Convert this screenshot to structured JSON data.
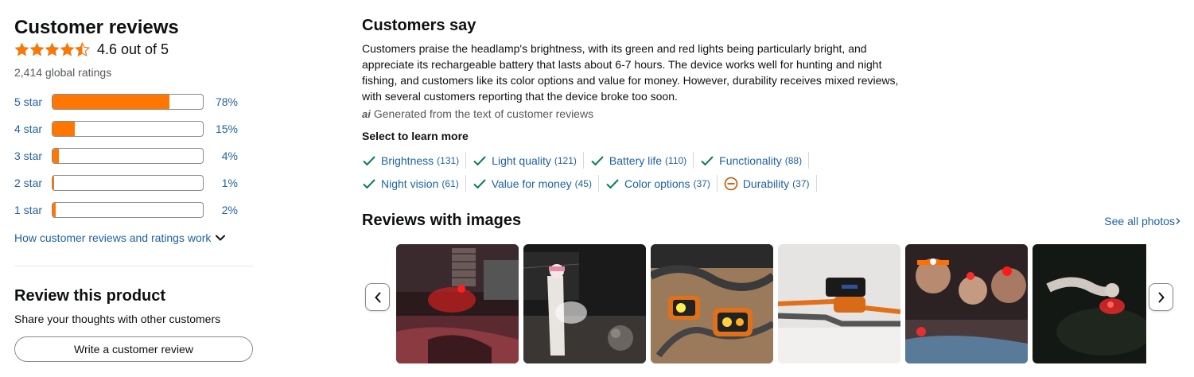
{
  "summary": {
    "title": "Customer reviews",
    "rating_value": 4.6,
    "rating_text": "4.6 out of 5",
    "global_ratings": "2,414 global ratings",
    "histogram": [
      {
        "label": "5 star",
        "percent": 78,
        "percent_text": "78%"
      },
      {
        "label": "4 star",
        "percent": 15,
        "percent_text": "15%"
      },
      {
        "label": "3 star",
        "percent": 4,
        "percent_text": "4%"
      },
      {
        "label": "2 star",
        "percent": 1,
        "percent_text": "1%"
      },
      {
        "label": "1 star",
        "percent": 2,
        "percent_text": "2%"
      }
    ],
    "how_link": "How customer reviews and ratings work"
  },
  "review_product": {
    "title": "Review this product",
    "subtitle": "Share your thoughts with other customers",
    "button_label": "Write a customer review"
  },
  "customers_say": {
    "title": "Customers say",
    "summary": "Customers praise the headlamp's brightness, with its green and red lights being particularly bright, and appreciate its rechargeable battery that lasts about 6-7 hours. The device works well for hunting and night fishing, and customers like its color options and value for money. However, durability receives mixed reviews, with several customers reporting that the device broke too soon.",
    "ai_icon": "ai",
    "ai_note": "Generated from the text of customer reviews",
    "select_label": "Select to learn more",
    "aspects": [
      [
        {
          "label": "Brightness",
          "count": "(131)",
          "sentiment": "positive"
        },
        {
          "label": "Light quality",
          "count": "(121)",
          "sentiment": "positive"
        },
        {
          "label": "Battery life",
          "count": "(110)",
          "sentiment": "positive"
        },
        {
          "label": "Functionality",
          "count": "(88)",
          "sentiment": "positive"
        }
      ],
      [
        {
          "label": "Night vision",
          "count": "(61)",
          "sentiment": "positive"
        },
        {
          "label": "Value for money",
          "count": "(45)",
          "sentiment": "positive"
        },
        {
          "label": "Color options",
          "count": "(37)",
          "sentiment": "positive"
        },
        {
          "label": "Durability",
          "count": "(37)",
          "sentiment": "mixed"
        }
      ]
    ]
  },
  "reviews_with_images": {
    "title": "Reviews with images",
    "see_all": "See all photos"
  },
  "colors": {
    "accent_orange": "#ff7600",
    "link_blue": "#2162a1",
    "positive_green": "#067d62",
    "mixed_orange": "#c45500"
  }
}
